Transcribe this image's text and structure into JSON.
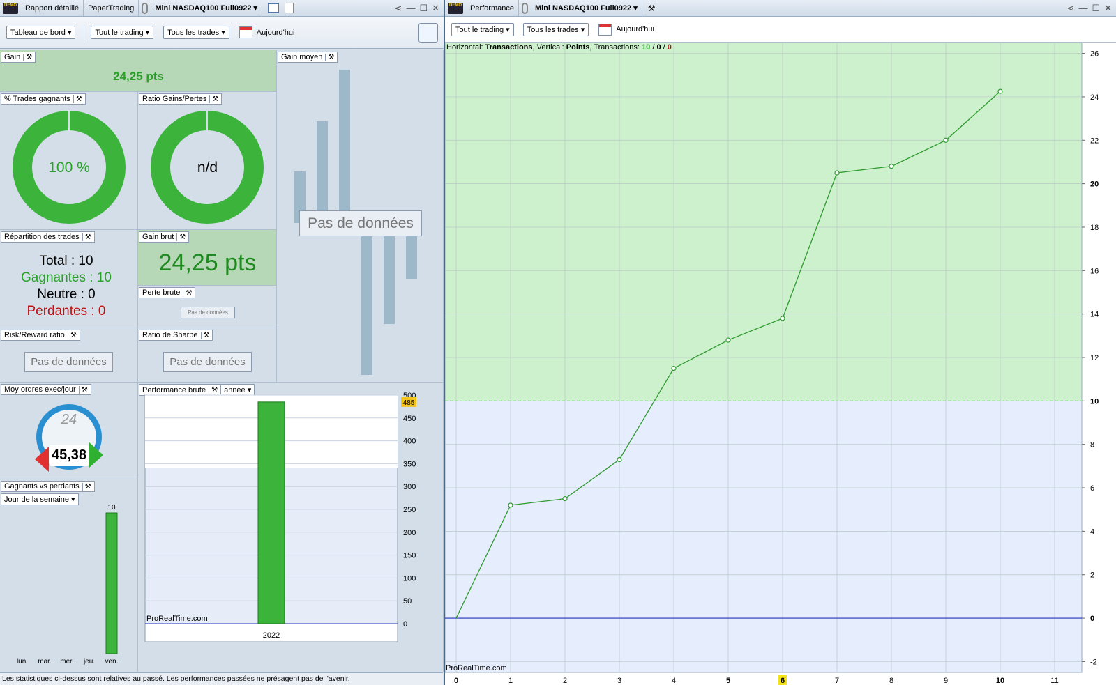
{
  "left_window": {
    "tabs": [
      "Rapport détaillé",
      "PaperTrading",
      "Mini NASDAQ100 Full0922"
    ],
    "toolbar": {
      "dashboard": "Tableau de bord",
      "scope": "Tout le trading",
      "trades": "Tous les trades",
      "date": "Aujourd'hui"
    },
    "gain": {
      "title": "Gain",
      "value": "24,25 pts"
    },
    "win_pct": {
      "title": "% Trades gagnants",
      "value": "100 %"
    },
    "ratio_gp": {
      "title": "Ratio Gains/Pertes",
      "value": "n/d"
    },
    "avg_gain": {
      "title": "Gain moyen",
      "nodata": "Pas de données"
    },
    "repartition": {
      "title": "Répartition des trades",
      "total": "Total : 10",
      "gagnantes": "Gagnantes : 10",
      "neutre": "Neutre : 0",
      "perdantes": "Perdantes : 0"
    },
    "gain_brut": {
      "title": "Gain brut",
      "value": "24,25 pts"
    },
    "perte_brute": {
      "title": "Perte brute",
      "nodata": "Pas de données"
    },
    "risk_reward": {
      "title": "Risk/Reward ratio",
      "nodata": "Pas de données"
    },
    "sharpe": {
      "title": "Ratio de Sharpe",
      "nodata": "Pas de données"
    },
    "moy_ordres": {
      "title": "Moy ordres exec/jour",
      "dial": "24",
      "value": "45,38"
    },
    "perf_brute": {
      "title": "Performance brute",
      "period": "année",
      "watermark": "ProRealTime.com"
    },
    "gvp": {
      "title": "Gagnants vs perdants",
      "period": "Jour de la semaine"
    },
    "status": "Les statistiques ci-dessus sont relatives au passé. Les performances passées ne présagent pas de l'avenir."
  },
  "right_window": {
    "title": "Performance",
    "instrument": "Mini NASDAQ100 Full0922",
    "toolbar": {
      "scope": "Tout le trading",
      "trades": "Tous les trades",
      "date": "Aujourd'hui"
    },
    "info": {
      "h_label": "Horizontal: ",
      "h_val": "Transactions",
      "v_label": ", Vertical: ",
      "v_val": "Points",
      "t_label": ", Transactions: ",
      "t_win": "10",
      "sep1": " / ",
      "t_neutral": "0",
      "sep2": " / ",
      "t_loss": "0"
    },
    "watermark": "ProRealTime.com"
  },
  "colors": {
    "green": "#2aa02a",
    "red": "#c01010",
    "bar_green": "#3cb43c",
    "line_green": "#2f9a2f"
  },
  "chart_data": [
    {
      "type": "bar",
      "categories": [
        "2022"
      ],
      "values": [
        485
      ],
      "ylim": [
        0,
        500
      ],
      "yticks": [
        0,
        50,
        100,
        150,
        200,
        250,
        300,
        350,
        400,
        450,
        500
      ],
      "marker_label": "485"
    },
    {
      "type": "bar",
      "categories": [
        "lun.",
        "mar.",
        "mer.",
        "jeu.",
        "ven."
      ],
      "values": [
        0,
        0,
        0,
        0,
        10
      ],
      "value_labels": [
        "",
        "",
        "",
        "",
        "10"
      ],
      "ylim": [
        0,
        10
      ]
    },
    {
      "type": "line",
      "x": [
        0,
        1,
        2,
        3,
        4,
        5,
        6,
        7,
        8,
        9,
        10
      ],
      "y": [
        0,
        5.2,
        5.5,
        7.3,
        11.5,
        12.8,
        13.8,
        20.5,
        20.8,
        22,
        24.25
      ],
      "xlim": [
        0,
        11.5
      ],
      "ylim": [
        -2.5,
        26.5
      ],
      "xticks": [
        0,
        1,
        2,
        3,
        4,
        5,
        6,
        7,
        8,
        9,
        10,
        11
      ],
      "yticks": [
        -2,
        0,
        2,
        4,
        6,
        8,
        10,
        12,
        14,
        16,
        18,
        20,
        22,
        24,
        26
      ],
      "threshold": 10,
      "highlight_x": "6"
    }
  ]
}
